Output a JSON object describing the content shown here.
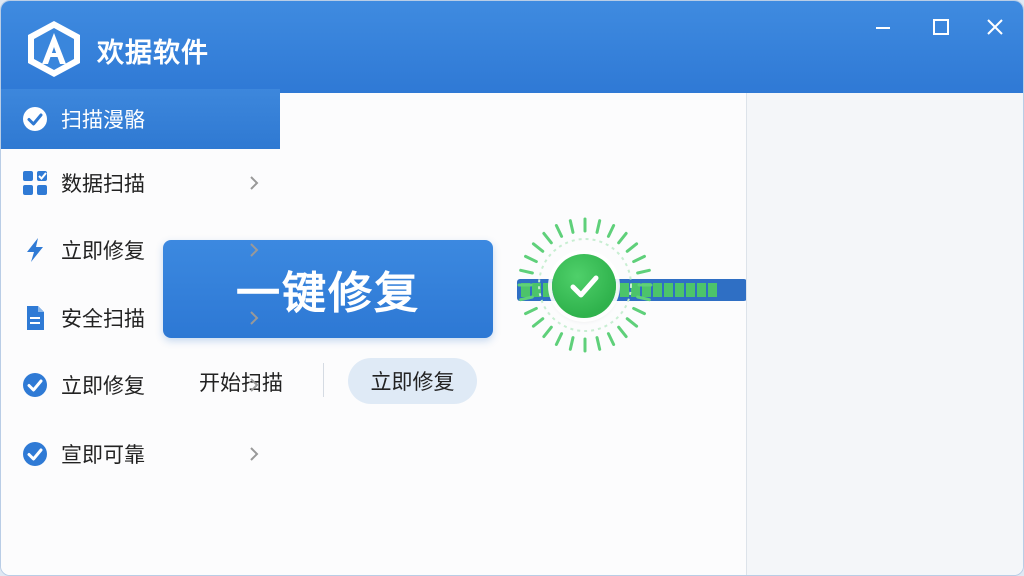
{
  "app": {
    "title": "欢据软件",
    "logo_letter": "A"
  },
  "colors": {
    "titlebar": "#3585dc",
    "primary": "#2f7ad5",
    "success": "#38b853",
    "sidebar_bg": "#f4f6f9"
  },
  "window_controls": {
    "minimize_icon": "minimize-icon",
    "maximize_icon": "maximize-icon",
    "close_icon": "close-icon"
  },
  "main": {
    "primary_button_label": "一键修复",
    "start_scan_label": "开始扫描",
    "repair_now_label": "立即修复",
    "progress": 0.9
  },
  "sidebar": {
    "items": [
      {
        "label": "扫描漫骼",
        "icon": "check-circle-icon",
        "active": true,
        "chevron": false
      },
      {
        "label": "数据扫描",
        "icon": "grid-icon",
        "active": false,
        "chevron": true
      },
      {
        "label": "立即修复",
        "icon": "lightning-icon",
        "active": false,
        "chevron": true
      },
      {
        "label": "安全扫描",
        "icon": "document-icon",
        "active": false,
        "chevron": true
      },
      {
        "label": "立即修复",
        "icon": "check-circle-icon",
        "active": false,
        "chevron": true
      },
      {
        "label": "宣即可靠",
        "icon": "check-circle-icon",
        "active": false,
        "chevron": true
      }
    ]
  }
}
